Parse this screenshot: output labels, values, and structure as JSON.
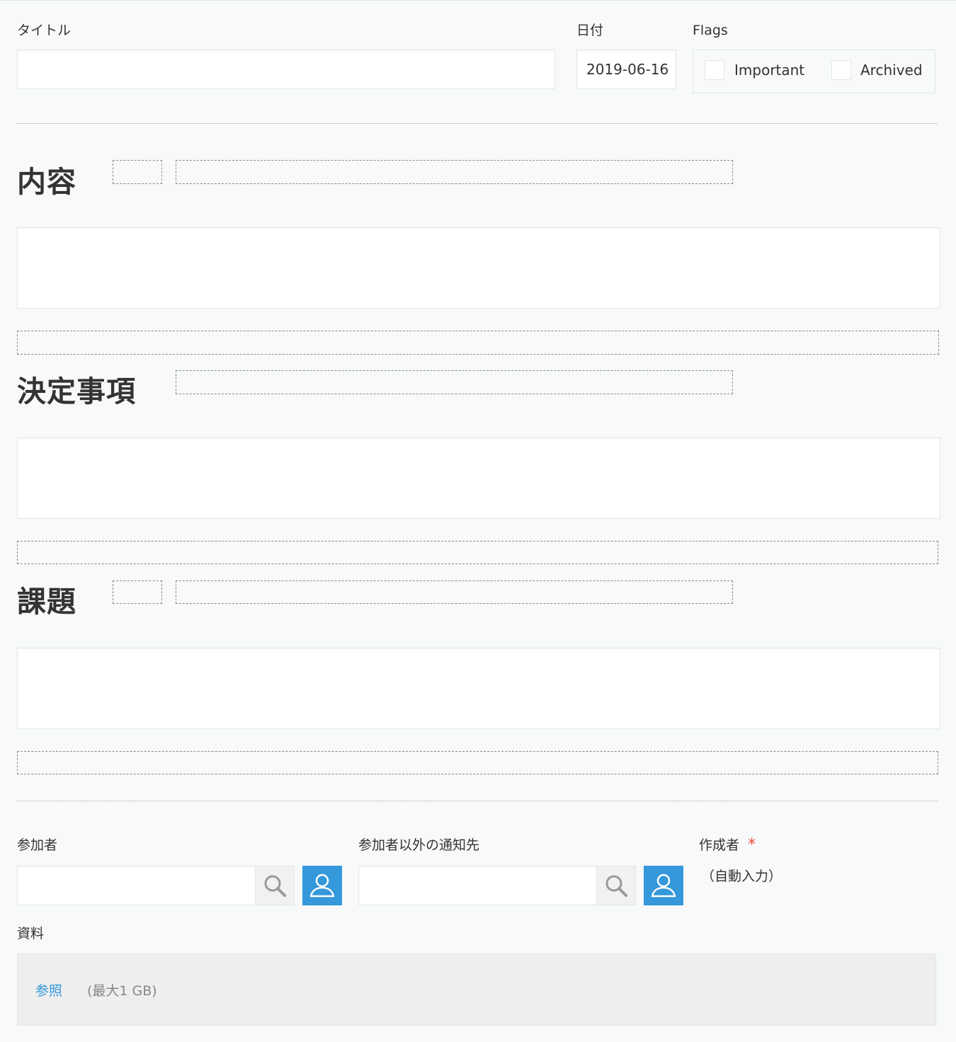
{
  "fields": {
    "title": {
      "label": "タイトル",
      "value": ""
    },
    "date": {
      "label": "日付",
      "value": "2019-06-16"
    },
    "flags": {
      "label": "Flags",
      "options": [
        {
          "label": "Important",
          "checked": false
        },
        {
          "label": "Archived",
          "checked": false
        }
      ]
    }
  },
  "sections": [
    {
      "heading": "内容",
      "text_value": ""
    },
    {
      "heading": "決定事項",
      "text_value": ""
    },
    {
      "heading": "課題",
      "text_value": ""
    }
  ],
  "participants": {
    "attendees": {
      "label": "参加者",
      "value": ""
    },
    "notify": {
      "label": "参加者以外の通知先",
      "value": ""
    },
    "creator": {
      "label": "作成者",
      "required_mark": "*",
      "auto_text": "（自動入力）"
    }
  },
  "attachments": {
    "label": "資料",
    "browse_label": "参照",
    "max_size": "(最大1 GB)"
  },
  "colors": {
    "accent": "#3498db",
    "required": "#e74c3c",
    "background": "#f7f9fa"
  },
  "icons": {
    "search": "search-icon",
    "user": "user-icon"
  }
}
